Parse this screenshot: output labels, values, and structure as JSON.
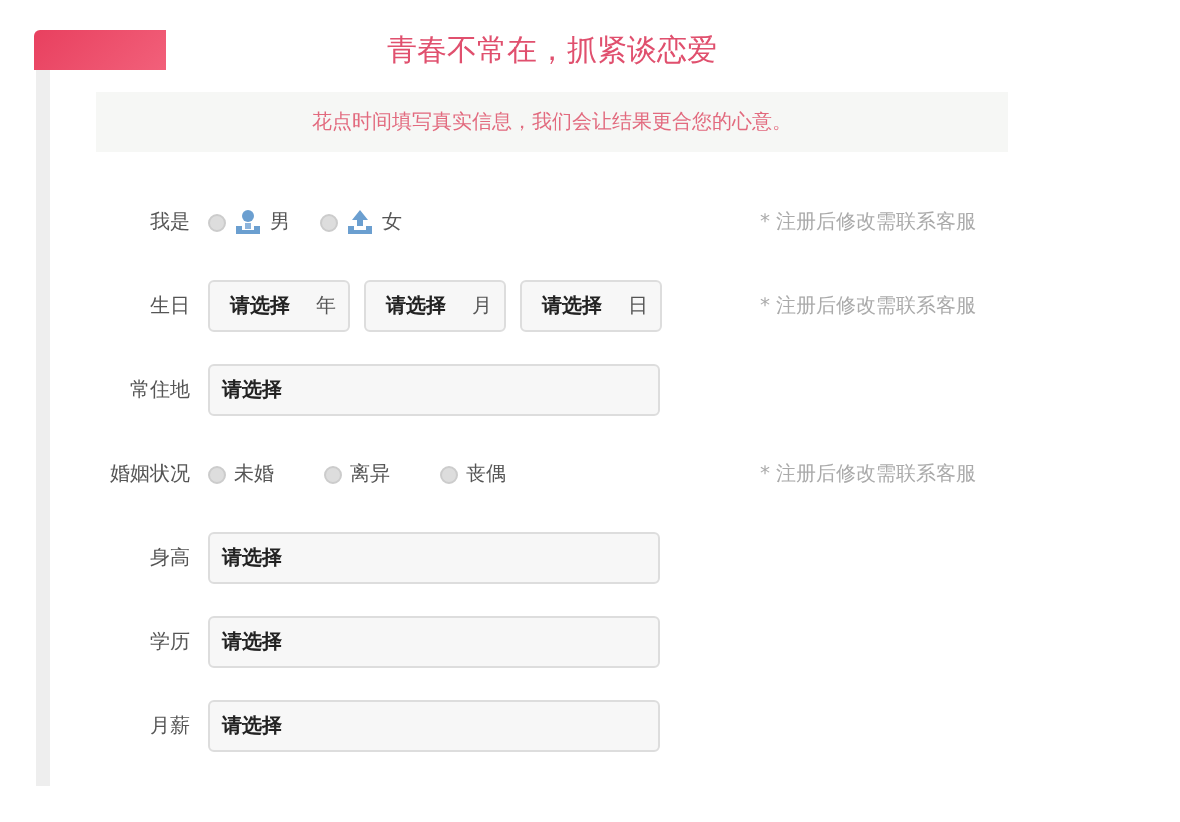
{
  "header": {
    "title": "青春不常在，抓紧谈恋爱",
    "notice": "花点时间填写真实信息，我们会让结果更合您的心意。"
  },
  "rows": [
    {
      "kind": "gender",
      "label": "我是",
      "options": [
        {
          "label": "男",
          "selected": false
        },
        {
          "label": "女",
          "selected": false
        }
      ],
      "hint": "* 注册后修改需联系客服"
    },
    {
      "kind": "date",
      "label": "生日",
      "parts": [
        {
          "value": "请选择",
          "unit": "年"
        },
        {
          "value": "请选择",
          "unit": "月"
        },
        {
          "value": "请选择",
          "unit": "日"
        }
      ],
      "hint": "* 注册后修改需联系客服"
    },
    {
      "kind": "select",
      "label": "常住地",
      "value": "请选择"
    },
    {
      "kind": "radio",
      "label": "婚姻状况",
      "options": [
        {
          "label": "未婚",
          "selected": false
        },
        {
          "label": "离异",
          "selected": false
        },
        {
          "label": "丧偶",
          "selected": false
        }
      ],
      "hint": "* 注册后修改需联系客服"
    },
    {
      "kind": "select",
      "label": "身高",
      "value": "请选择"
    },
    {
      "kind": "select",
      "label": "学历",
      "value": "请选择"
    },
    {
      "kind": "select",
      "label": "月薪",
      "value": "请选择"
    }
  ]
}
